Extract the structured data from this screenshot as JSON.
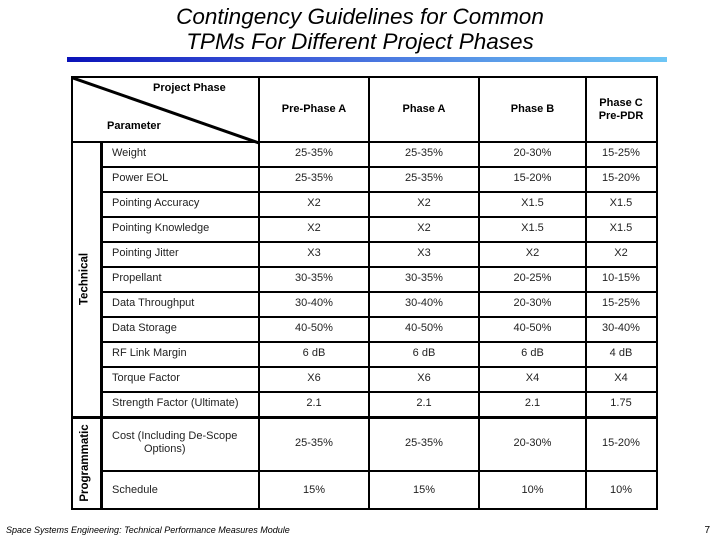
{
  "title": {
    "line1": "Contingency Guidelines for Common",
    "line2": "TPMs For Different Project Phases"
  },
  "table": {
    "corner": {
      "top_label": "Project Phase",
      "bottom_label": "Parameter"
    },
    "columns": [
      {
        "line1": "Pre-Phase A",
        "line2": ""
      },
      {
        "line1": "Phase A",
        "line2": ""
      },
      {
        "line1": "Phase B",
        "line2": ""
      },
      {
        "line1": "Phase C",
        "line2": "Pre-PDR"
      }
    ],
    "groups": [
      {
        "label": "Technical",
        "rows": [
          {
            "parameter": "Weight",
            "values": [
              "25-35%",
              "25-35%",
              "20-30%",
              "15-25%"
            ]
          },
          {
            "parameter": "Power EOL",
            "values": [
              "25-35%",
              "25-35%",
              "15-20%",
              "15-20%"
            ]
          },
          {
            "parameter": "Pointing Accuracy",
            "values": [
              "X2",
              "X2",
              "X1.5",
              "X1.5"
            ]
          },
          {
            "parameter": "Pointing Knowledge",
            "values": [
              "X2",
              "X2",
              "X1.5",
              "X1.5"
            ]
          },
          {
            "parameter": "Pointing Jitter",
            "values": [
              "X3",
              "X3",
              "X2",
              "X2"
            ]
          },
          {
            "parameter": "Propellant",
            "values": [
              "30-35%",
              "30-35%",
              "20-25%",
              "10-15%"
            ]
          },
          {
            "parameter": "Data Throughput",
            "values": [
              "30-40%",
              "30-40%",
              "20-30%",
              "15-25%"
            ]
          },
          {
            "parameter": "Data Storage",
            "values": [
              "40-50%",
              "40-50%",
              "40-50%",
              "30-40%"
            ]
          },
          {
            "parameter": "RF Link Margin",
            "values": [
              "6 dB",
              "6 dB",
              "6 dB",
              "4 dB"
            ]
          },
          {
            "parameter": "Torque Factor",
            "values": [
              "X6",
              "X6",
              "X4",
              "X4"
            ]
          },
          {
            "parameter": "Strength Factor (Ultimate)",
            "values": [
              "2.1",
              "2.1",
              "2.1",
              "1.75"
            ]
          }
        ]
      },
      {
        "label": "Programmatic",
        "rows": [
          {
            "parameter": "Cost (Including De-Scope",
            "parameter_line2": "Options)",
            "values": [
              "25-35%",
              "25-35%",
              "20-30%",
              "15-20%"
            ]
          },
          {
            "parameter": "Schedule",
            "values": [
              "15%",
              "15%",
              "10%",
              "10%"
            ]
          }
        ]
      }
    ]
  },
  "footer": {
    "text": "Space Systems Engineering: Technical Performance Measures Module",
    "page": "7"
  }
}
